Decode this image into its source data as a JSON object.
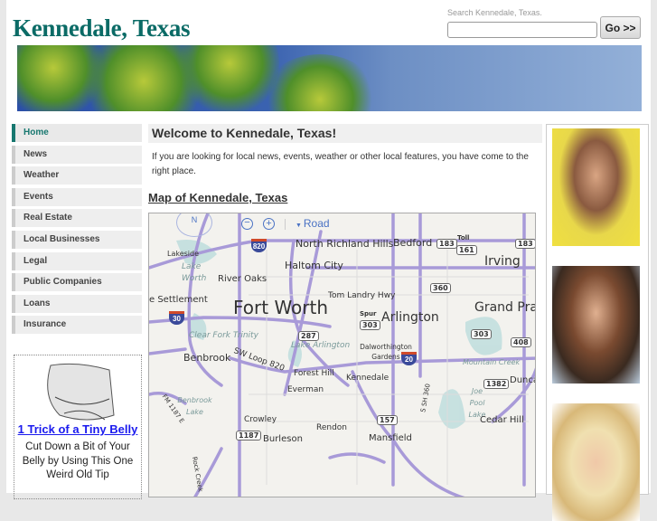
{
  "header": {
    "title": "Kennedale, Texas",
    "search_label": "Search Kennedale, Texas.",
    "search_value": "",
    "go_label": "Go >>"
  },
  "nav": {
    "items": [
      {
        "label": "Home"
      },
      {
        "label": "News"
      },
      {
        "label": "Weather"
      },
      {
        "label": "Events"
      },
      {
        "label": "Real Estate"
      },
      {
        "label": "Local Businesses"
      },
      {
        "label": "Legal"
      },
      {
        "label": "Public Companies"
      },
      {
        "label": "Loans"
      },
      {
        "label": "Insurance"
      }
    ]
  },
  "ad": {
    "link": "1 Trick of a Tiny Belly",
    "text": "Cut Down a Bit of Your Belly by Using This One Weird Old Tip"
  },
  "main": {
    "heading": "Welcome to Kennedale, Texas!",
    "intro": "If you are looking for local news, events, weather or other local features, you have come to the right place.",
    "map_title": "Map of Kennedale, Texas"
  },
  "map": {
    "compass": "N",
    "view": "Road",
    "labels": {
      "nrh": "North Richland Hills",
      "bedford": "Bedford",
      "irving": "Irving",
      "lakeside": "Lakeside",
      "lake_worth": "Lake Worth",
      "haltom": "Haltom City",
      "river_oaks": "River Oaks",
      "settlement": "e Settlement",
      "fort_worth": "Fort Worth",
      "tom_landry": "Tom Landry Hwy",
      "arlington": "Arlington",
      "grand_prairie": "Grand Pra",
      "clear_fork": "Clear Fork Trinity",
      "lake_arlington": "Lake Arlington",
      "dalworthington": "Dalworthington Gardens",
      "benbrook": "Benbrook",
      "sw_loop": "SW Loop 820",
      "forest_hill": "Forest Hill",
      "kennedale": "Kennedale",
      "everman": "Everman",
      "mountain_creek": "Mountain Creek",
      "duncanville": "Dunca",
      "benbrook_lake": "Benbrook Lake",
      "joe_pool": "Joe Pool Lake",
      "crowley": "Crowley",
      "rendon": "Rendon",
      "burleson": "Burleson",
      "mansfield": "Mansfield",
      "cedar_hill": "Cedar Hill",
      "sh360": "S SH 360",
      "rock_creek": "Rock Creek",
      "fm1187": "FM 1187 E",
      "toll": "Toll",
      "spur": "Spur"
    },
    "shields": {
      "i820": "820",
      "i30": "30",
      "i20": "20",
      "us287": "287",
      "s183a": "183",
      "s183b": "183",
      "s161": "161",
      "s360": "360",
      "s303a": "303",
      "s303b": "303",
      "s408": "408",
      "s1382": "1382",
      "s157": "157",
      "s1187": "1187"
    }
  },
  "colors": {
    "title": "#0b6b66",
    "nav_active": "#17776f",
    "link": "#1a1aee",
    "road": "#a89ad8"
  }
}
